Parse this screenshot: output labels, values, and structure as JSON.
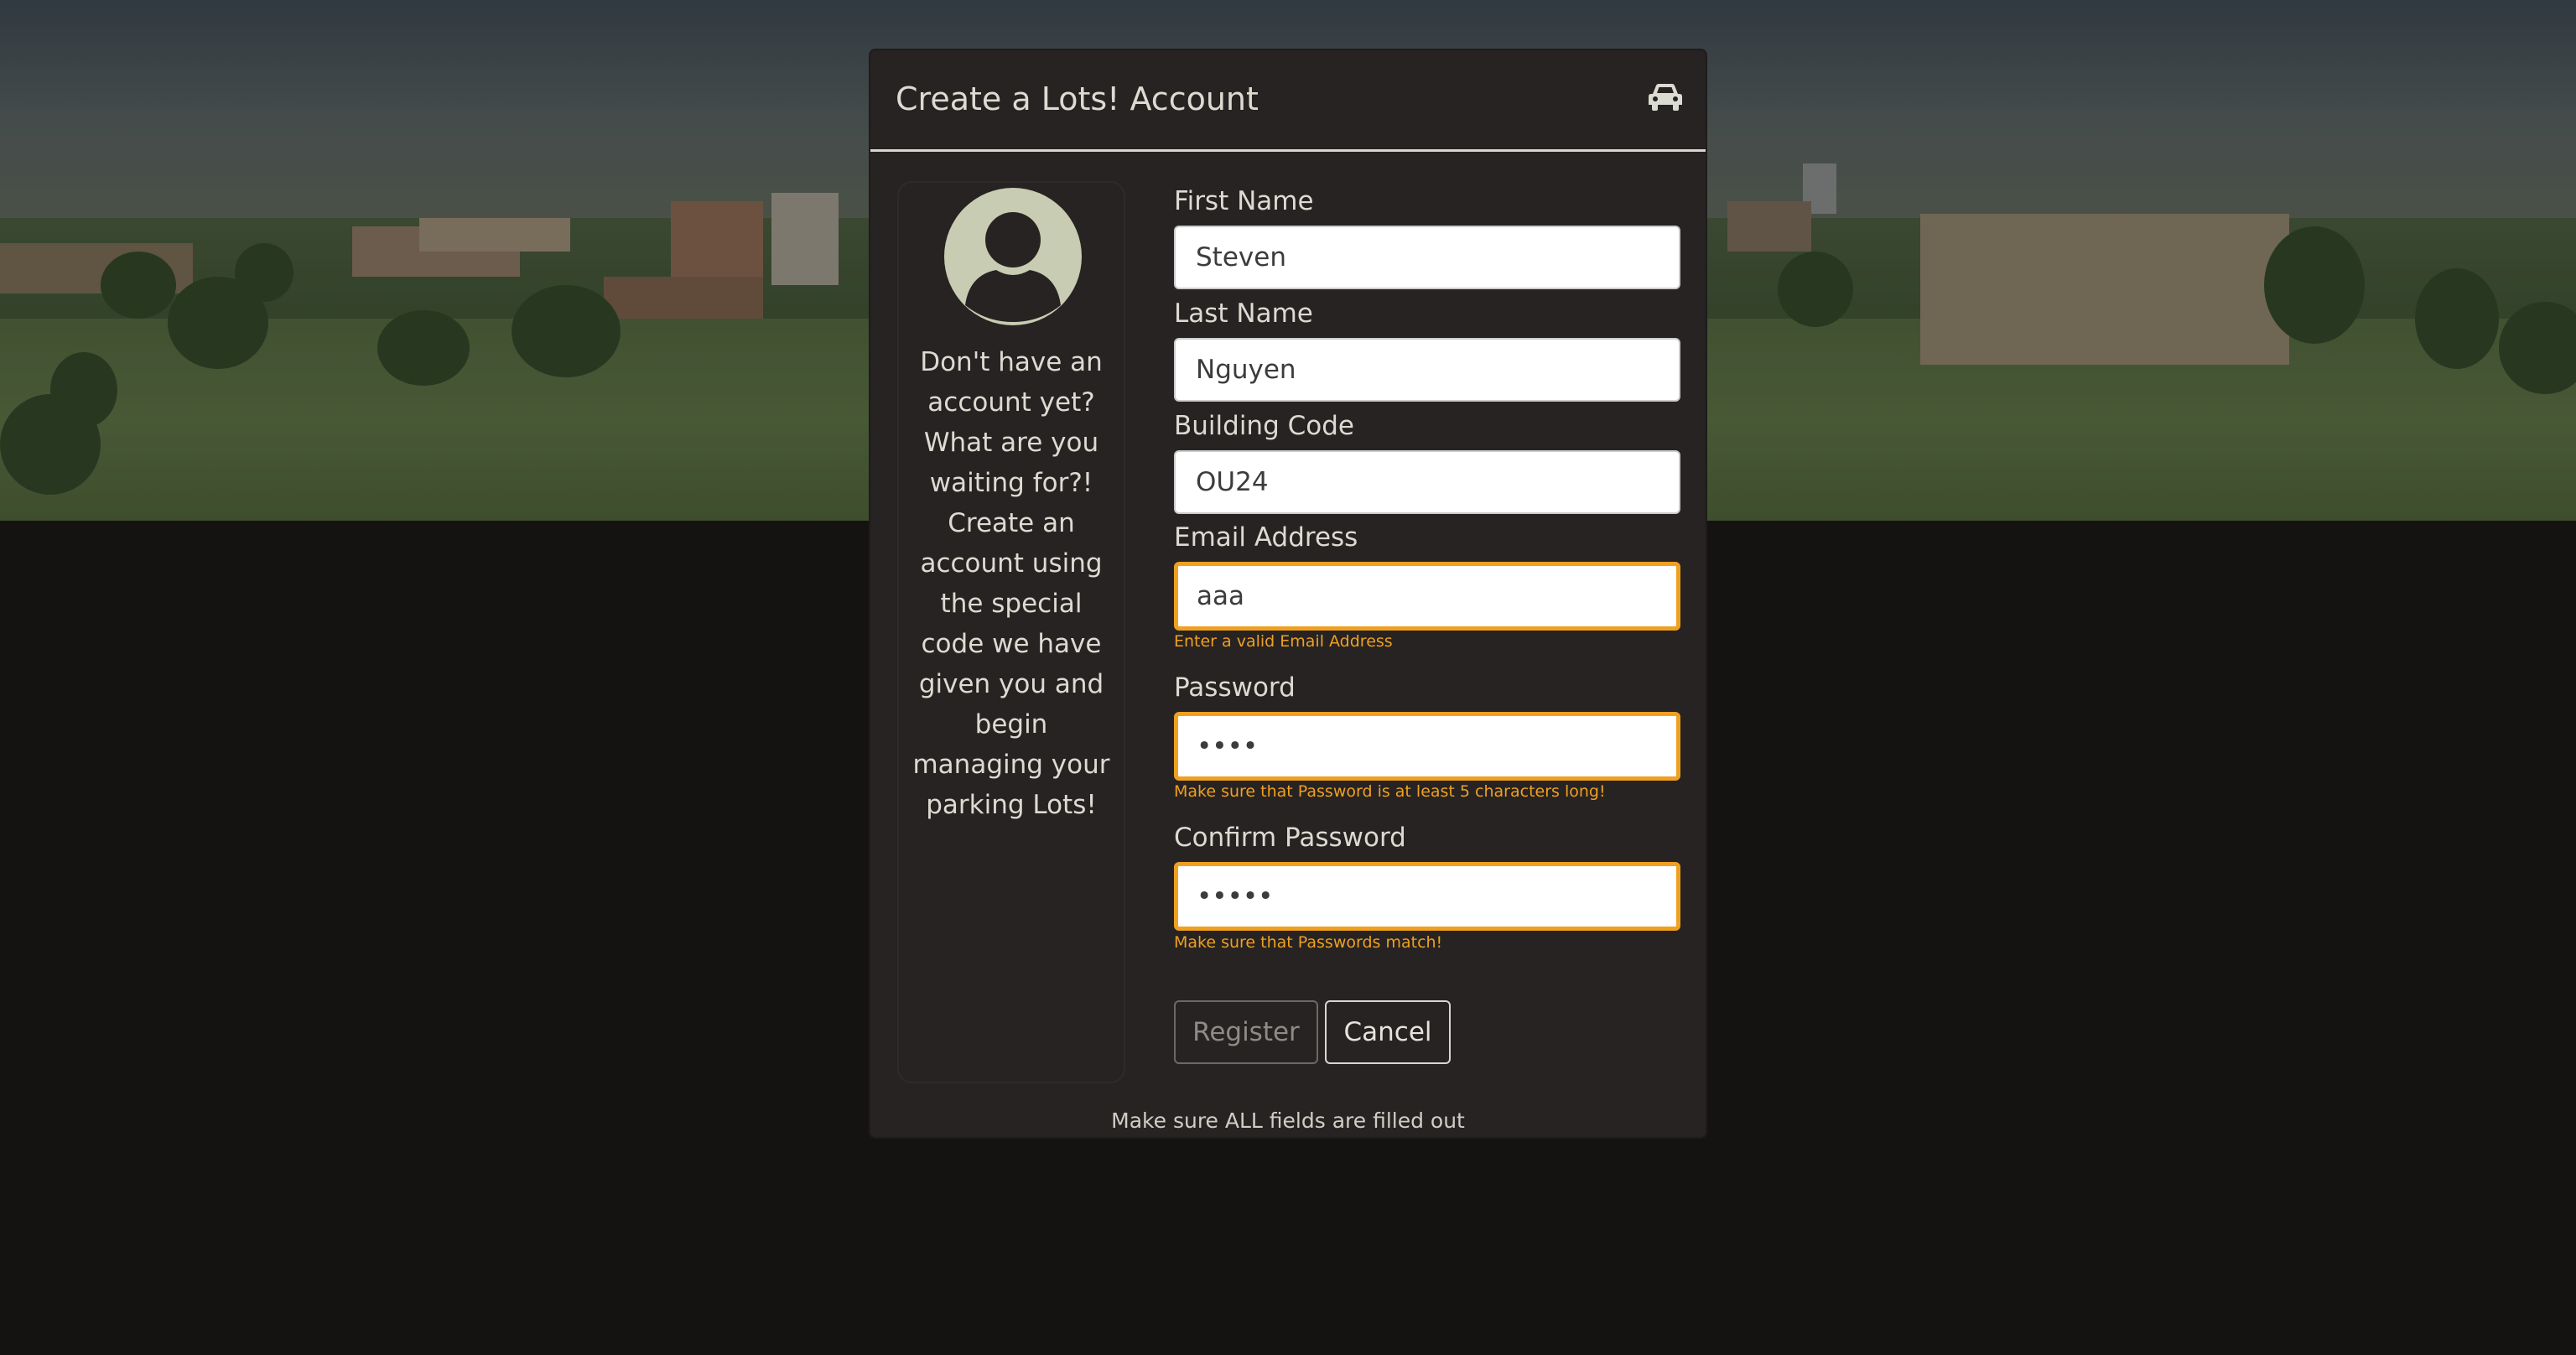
{
  "modal": {
    "title": "Create a Lots! Account",
    "header_icon": "car-icon"
  },
  "sidebar": {
    "avatar_icon": "user-avatar-icon",
    "message": "Don't have an account yet? What are you waiting for?! Create an account using the special code we have given you and begin managing your parking Lots!"
  },
  "form": {
    "first_name": {
      "label": "First Name",
      "value": "Steven"
    },
    "last_name": {
      "label": "Last Name",
      "value": "Nguyen"
    },
    "building_code": {
      "label": "Building Code",
      "value": "OU24"
    },
    "email": {
      "label": "Email Address",
      "value": "aaa",
      "error": "Enter a valid Email Address"
    },
    "password": {
      "label": "Password",
      "value": "xxxx",
      "error": "Make sure that Password is at least 5 characters long!"
    },
    "confirm_password": {
      "label": "Confirm Password",
      "value": "xxxxx",
      "error": "Make sure that Passwords match!"
    }
  },
  "buttons": {
    "register": "Register",
    "cancel": "Cancel"
  },
  "footer_note": "Make sure ALL fields are filled out",
  "colors": {
    "error": "#f0a020",
    "modal_bg": "#262322",
    "page_bg": "#141312"
  }
}
